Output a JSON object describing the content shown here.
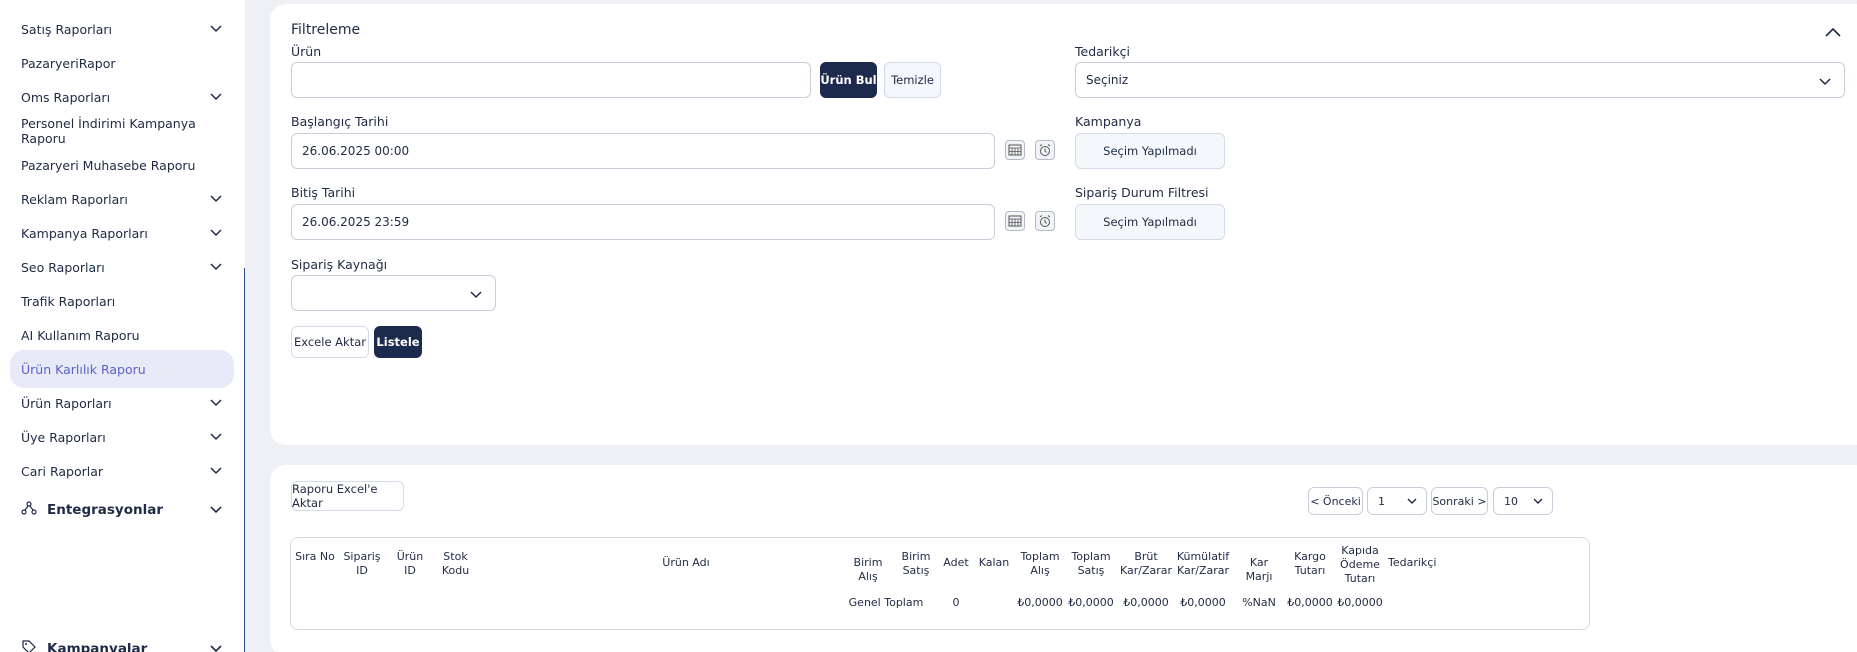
{
  "sidebar": {
    "items": [
      {
        "label": "Satış Raporları",
        "chevron": true
      },
      {
        "label": "PazaryeriRapor",
        "chevron": false
      },
      {
        "label": "Oms Raporları",
        "chevron": true
      },
      {
        "label": "Personel İndirimi Kampanya Raporu",
        "chevron": false
      },
      {
        "label": "Pazaryeri Muhasebe Raporu",
        "chevron": false
      },
      {
        "label": "Reklam Raporları",
        "chevron": true
      },
      {
        "label": "Kampanya Raporları",
        "chevron": true
      },
      {
        "label": "Seo Raporları",
        "chevron": true
      },
      {
        "label": "Trafik Raporları",
        "chevron": false
      },
      {
        "label": "AI Kullanım Raporu",
        "chevron": false
      },
      {
        "label": "Ürün Karlılık Raporu",
        "chevron": false,
        "active": true
      },
      {
        "label": "Ürün Raporları",
        "chevron": true
      },
      {
        "label": "Üye Raporları",
        "chevron": true
      },
      {
        "label": "Cari Raporlar",
        "chevron": true
      }
    ],
    "sections": [
      {
        "label": "Entegrasyonlar",
        "icon": "integration-icon"
      },
      {
        "label": "Kampanyalar",
        "icon": "tag-icon"
      }
    ]
  },
  "filter": {
    "title": "Filtreleme",
    "urun_label": "Ürün",
    "urun_value": "",
    "urun_bul": "Ürün Bul",
    "temizle": "Temizle",
    "tedarikci_label": "Tedarikçi",
    "tedarikci_value": "Seçiniz",
    "baslangic_label": "Başlangıç Tarihi",
    "baslangic_value": "26.06.2025 00:00",
    "kampanya_label": "Kampanya",
    "kampanya_value": "Seçim Yapılmadı",
    "bitis_label": "Bitiş Tarihi",
    "bitis_value": "26.06.2025 23:59",
    "siparis_durum_label": "Sipariş Durum Filtresi",
    "siparis_durum_value": "Seçim Yapılmadı",
    "siparis_kaynagi_label": "Sipariş Kaynağı",
    "siparis_kaynagi_value": "",
    "excel_aktar": "Excele Aktar",
    "listele": "Listele"
  },
  "results": {
    "export_button": "Raporu Excel'e Aktar",
    "pagination": {
      "prev": "< Önceki",
      "page": "1",
      "next": "Sonraki >",
      "page_size": "10"
    },
    "columns": [
      "Sıra No",
      "Sipariş ID",
      "Ürün ID",
      "Stok Kodu",
      "Ürün Adı",
      "Birim Alış",
      "Birim Satış",
      "Adet",
      "Kalan",
      "Toplam Alış",
      "Toplam Satış",
      "Brüt Kar/Zarar",
      "Kümülatif Kar/Zarar",
      "Kar Marjı",
      "Kargo Tutarı",
      "Kapıda Ödeme Tutarı",
      "Tedarikçi"
    ],
    "total_row": {
      "label": "Genel Toplam",
      "adet": "0",
      "toplam_alis": "₺0,0000",
      "toplam_satis": "₺0,0000",
      "brut": "₺0,0000",
      "kumulatif": "₺0,0000",
      "kar_marji": "%NaN",
      "kargo": "₺0,0000",
      "kapida": "₺0,0000"
    }
  }
}
